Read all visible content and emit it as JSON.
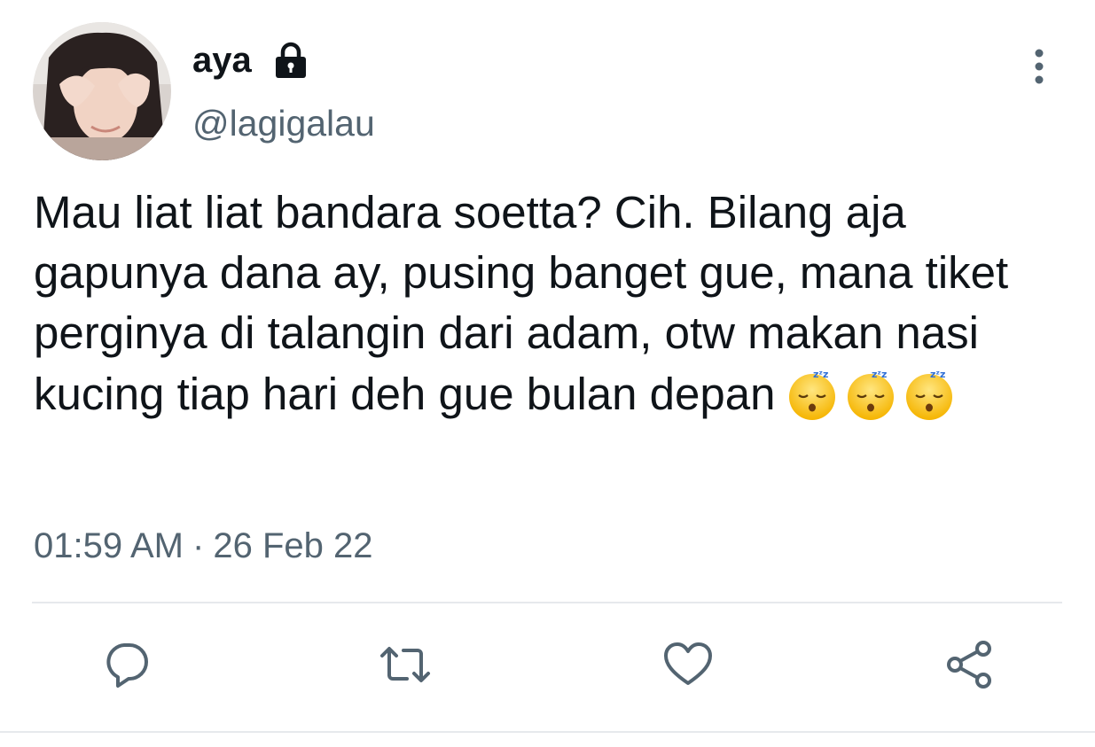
{
  "tweet": {
    "display_name": "aya",
    "handle": "@lagigalau",
    "text": "Mau liat liat bandara soetta? Cih. Bilang aja gapunya dana ay, pusing banget gue, mana tiket perginya di talangin dari adam, otw makan nasi kucing tiap hari deh gue bulan depan",
    "time": "01:59 AM",
    "separator": "·",
    "date": "26 Feb 22",
    "emoji_icons": [
      "sleeping-face-icon",
      "sleeping-face-icon",
      "sleeping-face-icon"
    ]
  },
  "icons": {
    "lock": "lock-icon",
    "more": "more-vertical-icon",
    "reply": "reply-icon",
    "retweet": "retweet-icon",
    "like": "heart-icon",
    "share": "share-icon"
  },
  "colors": {
    "text": "#0f1419",
    "secondary": "#536471",
    "divider": "#e6e9ec"
  }
}
